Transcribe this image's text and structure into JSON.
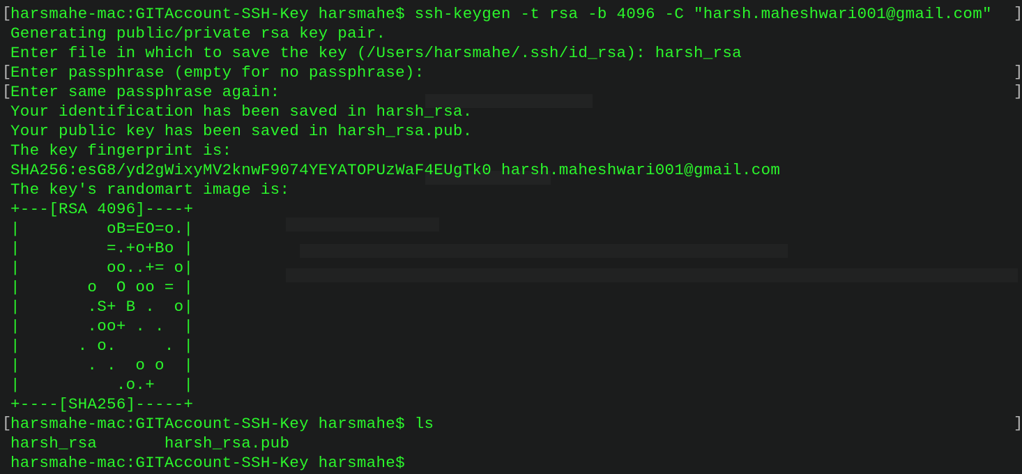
{
  "colors": {
    "background": "#1b1c1c",
    "text": "#2bf52b",
    "bracket": "#b9b9b9"
  },
  "terminal": {
    "lines": [
      {
        "text": "harsmahe-mac:GITAccount-SSH-Key harsmahe$ ssh-keygen -t rsa -b 4096 -C \"harsh.maheshwari001@gmail.com\"",
        "bracket_left": "[",
        "bracket_right": "]"
      },
      {
        "text": "Generating public/private rsa key pair."
      },
      {
        "text": "Enter file in which to save the key (/Users/harsmahe/.ssh/id_rsa): harsh_rsa"
      },
      {
        "text": "Enter passphrase (empty for no passphrase):",
        "bracket_left": "[",
        "bracket_right": "]"
      },
      {
        "text": "Enter same passphrase again:",
        "bracket_left": "[",
        "bracket_right": "]"
      },
      {
        "text": "Your identification has been saved in harsh_rsa."
      },
      {
        "text": "Your public key has been saved in harsh_rsa.pub."
      },
      {
        "text": "The key fingerprint is:"
      },
      {
        "text": "SHA256:esG8/yd2gWixyMV2knwF9074YEYATOPUzWaF4EUgTk0 harsh.maheshwari001@gmail.com"
      },
      {
        "text": "The key's randomart image is:"
      },
      {
        "text": "+---[RSA 4096]----+"
      },
      {
        "text": "|         oB=EO=o.|"
      },
      {
        "text": "|         =.+o+Bo |"
      },
      {
        "text": "|         oo..+= o|"
      },
      {
        "text": "|       o  O oo = |"
      },
      {
        "text": "|       .S+ B .  o|"
      },
      {
        "text": "|       .oo+ . .  |"
      },
      {
        "text": "|      . o.     . |"
      },
      {
        "text": "|       . .  o o  |"
      },
      {
        "text": "|          .o.+   |"
      },
      {
        "text": "+----[SHA256]-----+"
      },
      {
        "text": "harsmahe-mac:GITAccount-SSH-Key harsmahe$ ls",
        "bracket_left": "[",
        "bracket_right": "]"
      },
      {
        "text": "harsh_rsa       harsh_rsa.pub"
      },
      {
        "text": "harsmahe-mac:GITAccount-SSH-Key harsmahe$"
      }
    ]
  }
}
